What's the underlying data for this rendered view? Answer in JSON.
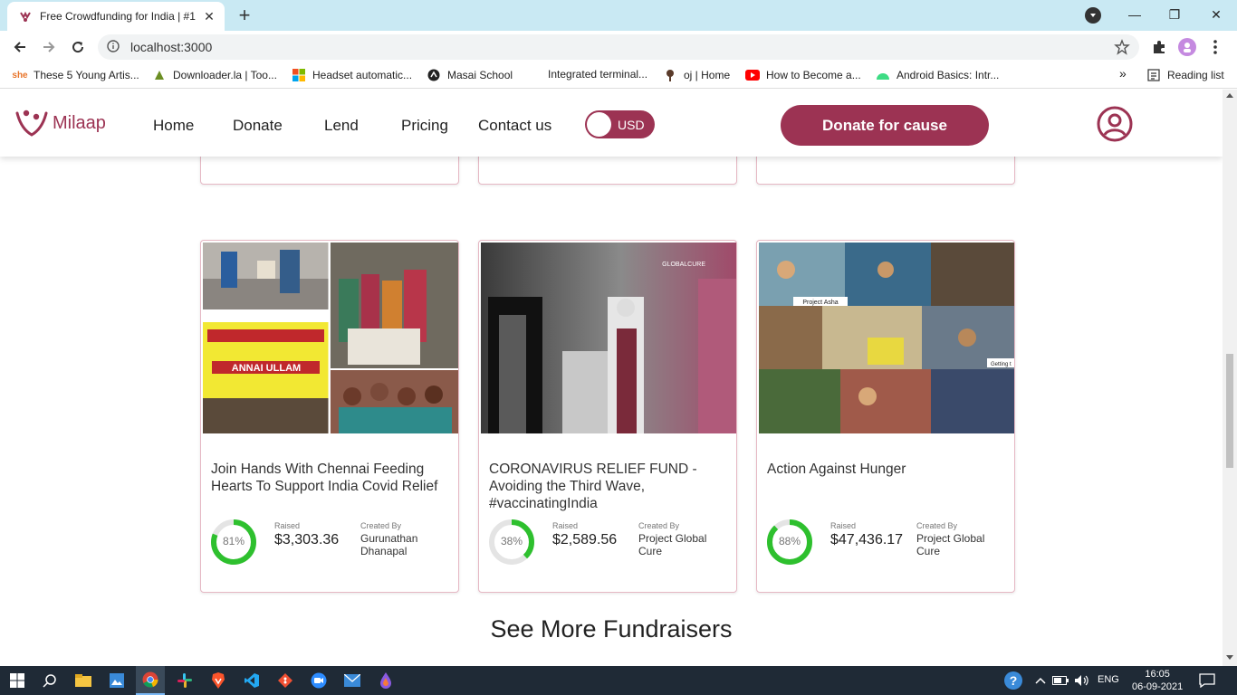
{
  "browser": {
    "tab_title": "Free Crowdfunding for India | #1",
    "url": "localhost:3000",
    "bookmarks": [
      {
        "label": "These 5 Young Artis...",
        "icon": "she-icon"
      },
      {
        "label": "Downloader.la | Too...",
        "icon": "downloader-icon"
      },
      {
        "label": "Headset automatic...",
        "icon": "microsoft-icon"
      },
      {
        "label": "Masai School",
        "icon": "masai-icon"
      },
      {
        "label": "Integrated terminal...",
        "icon": "vscode-docs-icon"
      },
      {
        "label": "oj | Home",
        "icon": "oj-icon"
      },
      {
        "label": "How to Become a...",
        "icon": "youtube-icon"
      },
      {
        "label": "Android Basics: Intr...",
        "icon": "android-icon"
      }
    ],
    "overflow": "»",
    "reading_list": "Reading list"
  },
  "site": {
    "logo_text": "Milaap",
    "nav": [
      "Home",
      "Donate",
      "Lend",
      "Pricing",
      "Contact us"
    ],
    "currency_toggle": "USD",
    "donate_button": "Donate for cause"
  },
  "cards": [
    {
      "title": "Join Hands With Chennai Feeding Hearts To Support India Covid Relief",
      "percent": 81,
      "percent_label": "81%",
      "raised_label": "Raised",
      "raised": "$3,303.36",
      "created_label": "Created By",
      "created_by": "Gurunathan Dhanapal"
    },
    {
      "title": "CORONAVIRUS RELIEF FUND - Avoiding the Third Wave, #vaccinatingIndia",
      "percent": 38,
      "percent_label": "38%",
      "raised_label": "Raised",
      "raised": "$2,589.56",
      "created_label": "Created By",
      "created_by": "Project Global Cure",
      "image_overlay": "GLOBALCURE"
    },
    {
      "title": "Action Against Hunger",
      "percent": 88,
      "percent_label": "88%",
      "raised_label": "Raised",
      "raised": "$47,436.17",
      "created_label": "Created By",
      "created_by": "Project Global Cure"
    }
  ],
  "image_text": {
    "annai": "ANNAI ULLAM",
    "asha": "Project Asha",
    "getting": "Getting t"
  },
  "see_more": "See More Fundraisers",
  "taskbar": {
    "lang": "ENG",
    "time": "16:05",
    "date": "06-09-2021"
  },
  "colors": {
    "brand": "#9c3353",
    "progress": "#2ec02e"
  }
}
